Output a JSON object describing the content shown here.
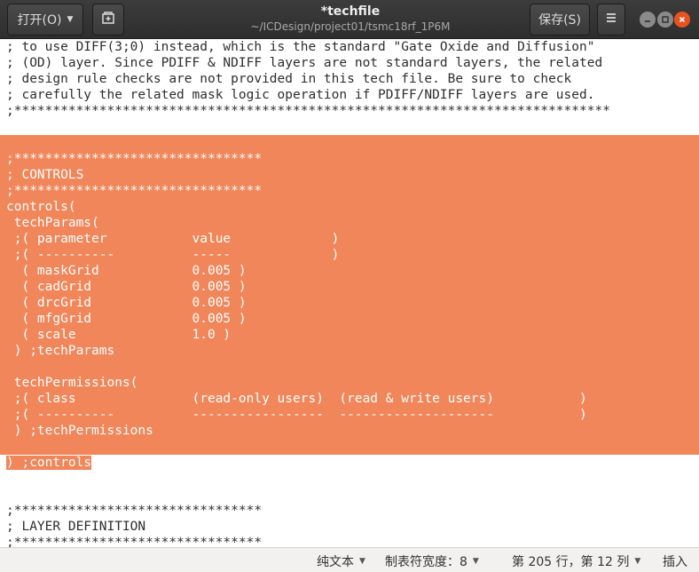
{
  "header": {
    "open_label": "打开(O)",
    "save_label": "保存(S)",
    "title": "*techfile",
    "subtitle": "~/ICDesign/project01/tsmc18rf_1P6M"
  },
  "editor": {
    "lines": [
      "; to use DIFF(3;0) instead, which is the standard \"Gate Oxide and Diffusion\"",
      "; (OD) layer. Since PDIFF & NDIFF layers are not standard layers, the related",
      "; design rule checks are not provided in this tech file. Be sure to check",
      "; carefully the related mask logic operation if PDIFF/NDIFF layers are used.",
      ";*****************************************************************************",
      "",
      "",
      ";********************************",
      "; CONTROLS",
      ";********************************",
      "controls(",
      " techParams(",
      " ;( parameter           value             )",
      " ;( ----------          -----             )",
      "  ( maskGrid            0.005 )",
      "  ( cadGrid             0.005 )",
      "  ( drcGrid             0.005 )",
      "  ( mfgGrid             0.005 )",
      "  ( scale               1.0 )",
      " ) ;techParams",
      "",
      " techPermissions(",
      " ;( class               (read-only users)  (read & write users)           )",
      " ;( ----------          -----------------  --------------------           )",
      " ) ;techPermissions",
      "",
      ") ;controls",
      "",
      "",
      ";********************************",
      "; LAYER DEFINITION",
      ";********************************"
    ]
  },
  "statusbar": {
    "syntax": "纯文本",
    "tab_width": "制表符宽度：8",
    "position": "第 205 行，第 12 列",
    "mode": "插入"
  },
  "colors": {
    "selection": "#f0865a",
    "header_bg": "#353535",
    "close_button": "#e8521f"
  }
}
